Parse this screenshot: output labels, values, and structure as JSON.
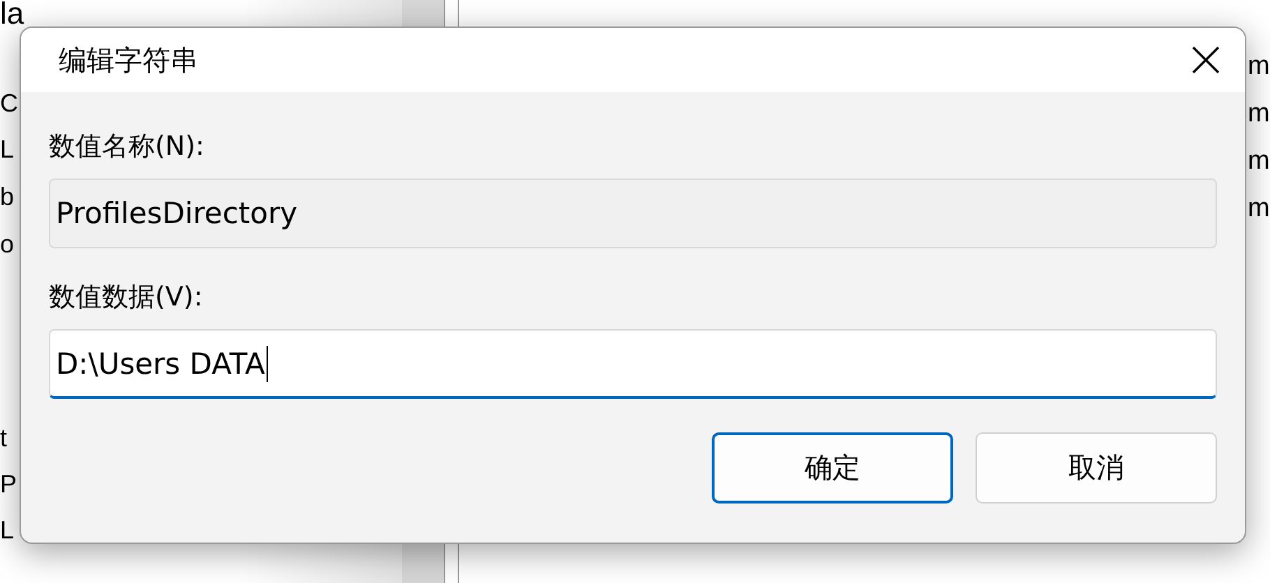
{
  "background": {
    "left_items": [
      "la",
      "C",
      "L",
      "b",
      "o",
      "t",
      "P",
      "L"
    ],
    "right_items": [
      "m",
      "m",
      "m",
      "m"
    ]
  },
  "dialog": {
    "title": "编辑字符串",
    "name_label": "数值名称(N):",
    "name_field": {
      "value": "ProfilesDirectory",
      "readonly": true
    },
    "data_label": "数值数据(V):",
    "data_field": {
      "value": "D:\\Users DATA",
      "focused": true
    },
    "buttons": [
      {
        "label": "确定",
        "default": true
      },
      {
        "label": "取消",
        "default": false
      }
    ]
  }
}
